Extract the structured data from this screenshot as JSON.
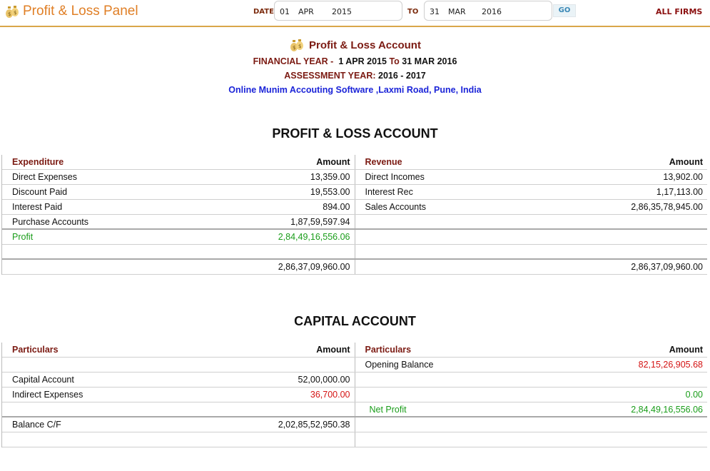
{
  "header": {
    "app_title": "Profit & Loss Panel",
    "date_label": "DATE:",
    "from": {
      "day": "01",
      "month": "APR",
      "year": "2015"
    },
    "to_label": "TO",
    "to": {
      "day": "31",
      "month": "MAR",
      "year": "2016"
    },
    "go_label": "GO",
    "firm_selector": "ALL FIRMS"
  },
  "report": {
    "title": "Profit & Loss Account",
    "fy_label": "FINANCIAL YEAR -",
    "fy_from": "1 APR 2015",
    "fy_to_word": "To",
    "fy_to": "31 MAR 2016",
    "ay_label": "ASSESSMENT YEAR:",
    "ay_value": "2016 - 2017",
    "company": "Online Munim Accouting Software ,Laxmi Road, Pune, India"
  },
  "pl": {
    "section_title": "PROFIT & LOSS ACCOUNT",
    "left_header": "Expenditure",
    "left_amount_header": "Amount",
    "right_header": "Revenue",
    "right_amount_header": "Amount",
    "rows": [
      {
        "l": "Direct Expenses",
        "la": "13,359.00",
        "r": "Direct Incomes",
        "ra": "13,902.00"
      },
      {
        "l": "Discount Paid",
        "la": "19,553.00",
        "r": "Interest Rec",
        "ra": "1,17,113.00"
      },
      {
        "l": "Interest Paid",
        "la": "894.00",
        "r": "Sales Accounts",
        "ra": "2,86,35,78,945.00"
      },
      {
        "l": "Purchase Accounts",
        "la": "1,87,59,597.94",
        "r": "",
        "ra": ""
      }
    ],
    "profit_label": "Profit",
    "profit_amount": "2,84,49,16,556.06",
    "left_total": "2,86,37,09,960.00",
    "right_total": "2,86,37,09,960.00"
  },
  "capital": {
    "section_title": "CAPITAL ACCOUNT",
    "left_header": "Particulars",
    "left_amount_header": "Amount",
    "right_header": "Particulars",
    "right_amount_header": "Amount",
    "opening_balance_label": "Opening Balance",
    "opening_balance": "82,15,26,905.68",
    "capital_account_label": "Capital Account",
    "capital_account": "52,00,000.00",
    "indirect_expenses_label": "Indirect Expenses",
    "indirect_expenses": "36,700.00",
    "zero_value": "0.00",
    "net_profit_label": "Net Profit",
    "net_profit": "2,84,49,16,556.06",
    "balance_cf_label": "Balance C/F",
    "balance_cf": "2,02,85,52,950.38"
  },
  "colors": {
    "accent_orange": "#e07f26",
    "dark_red": "#7b1a12",
    "profit_green": "#1a9d1a",
    "negative_red": "#d41414",
    "link_blue": "#1b24d8"
  }
}
